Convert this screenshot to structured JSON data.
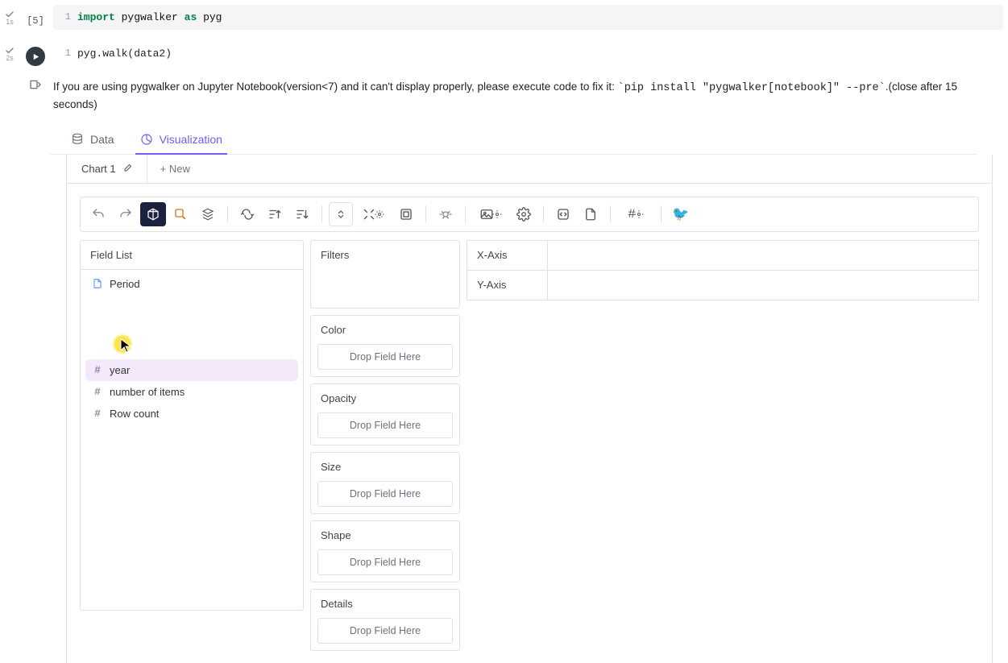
{
  "cells": {
    "c1": {
      "exec_label": "[5]",
      "duration": "1s",
      "lineno": "1",
      "kw_import": "import",
      "mod": "pygwalker",
      "kw_as": "as",
      "alias": "pyg"
    },
    "c2": {
      "duration": "2s",
      "lineno": "1",
      "code": "pyg.walk(data2)"
    }
  },
  "output_note": {
    "prefix": "If you are using pygwalker on Jupyter Notebook(version<7) and it can't display properly, please execute code to fix it: ",
    "cmd": "`pip install \"pygwalker[notebook]\" --pre`",
    "suffix": ".(close after 15 seconds)"
  },
  "main_tabs": {
    "data": "Data",
    "viz": "Visualization"
  },
  "chart_tabs": {
    "chart1": "Chart 1",
    "new": "+ New"
  },
  "panels": {
    "field_list": "Field List",
    "filters": "Filters",
    "color": "Color",
    "opacity": "Opacity",
    "size": "Size",
    "shape": "Shape",
    "details": "Details",
    "x_axis": "X-Axis",
    "y_axis": "Y-Axis"
  },
  "drop_hint": "Drop Field Here",
  "fields": {
    "period": "Period",
    "year": "year",
    "items": "number of items",
    "rowcount": "Row count"
  }
}
